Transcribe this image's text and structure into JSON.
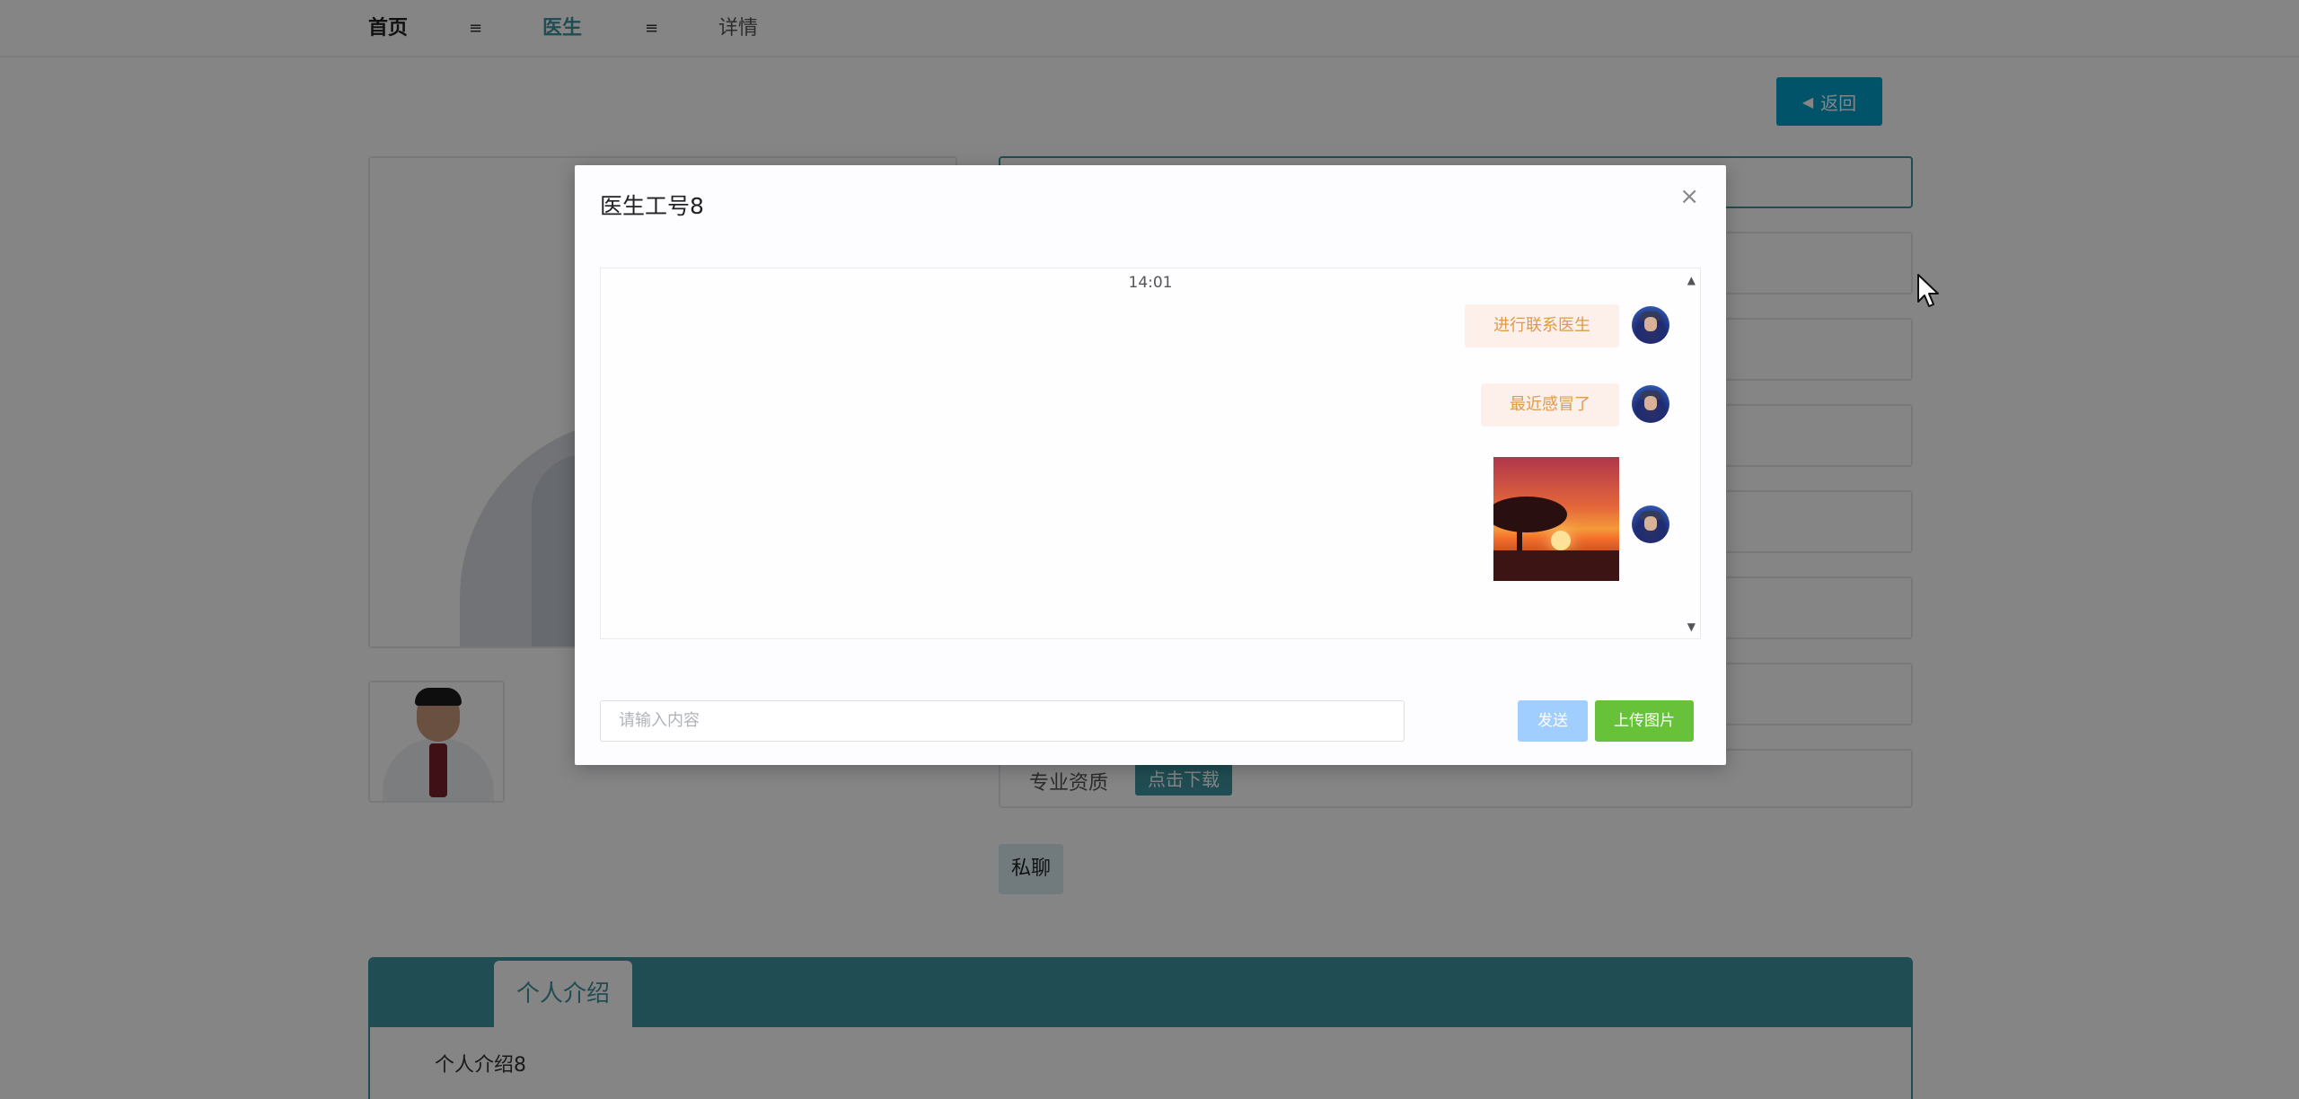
{
  "breadcrumb": {
    "home": "首页",
    "separator": "≡",
    "doctor": "医生",
    "detail": "详情"
  },
  "back_button": {
    "label": "返回",
    "icon": "caret-left-icon"
  },
  "info": {
    "qualification_label": "专业资质",
    "download_label": "点击下载"
  },
  "private_chat_label": "私聊",
  "tabs": {
    "active_label": "个人介绍",
    "content": "个人介绍8"
  },
  "modal": {
    "title": "医生工号8",
    "close_icon": "×",
    "chat": {
      "time": "14:01",
      "messages": [
        {
          "type": "text",
          "text": "进行联系医生"
        },
        {
          "type": "text",
          "text": "最近感冒了"
        },
        {
          "type": "image",
          "image": "sunset-photo"
        }
      ]
    },
    "input_placeholder": "请输入内容",
    "send_label": "发送",
    "upload_label": "上传图片"
  },
  "colors": {
    "accent": "#3f95a0",
    "back_button": "#00a0c7",
    "bubble_bg": "#fdf0ea",
    "bubble_text": "#e09a45",
    "send_button": "#a0cfff",
    "upload_button": "#67c23a"
  }
}
